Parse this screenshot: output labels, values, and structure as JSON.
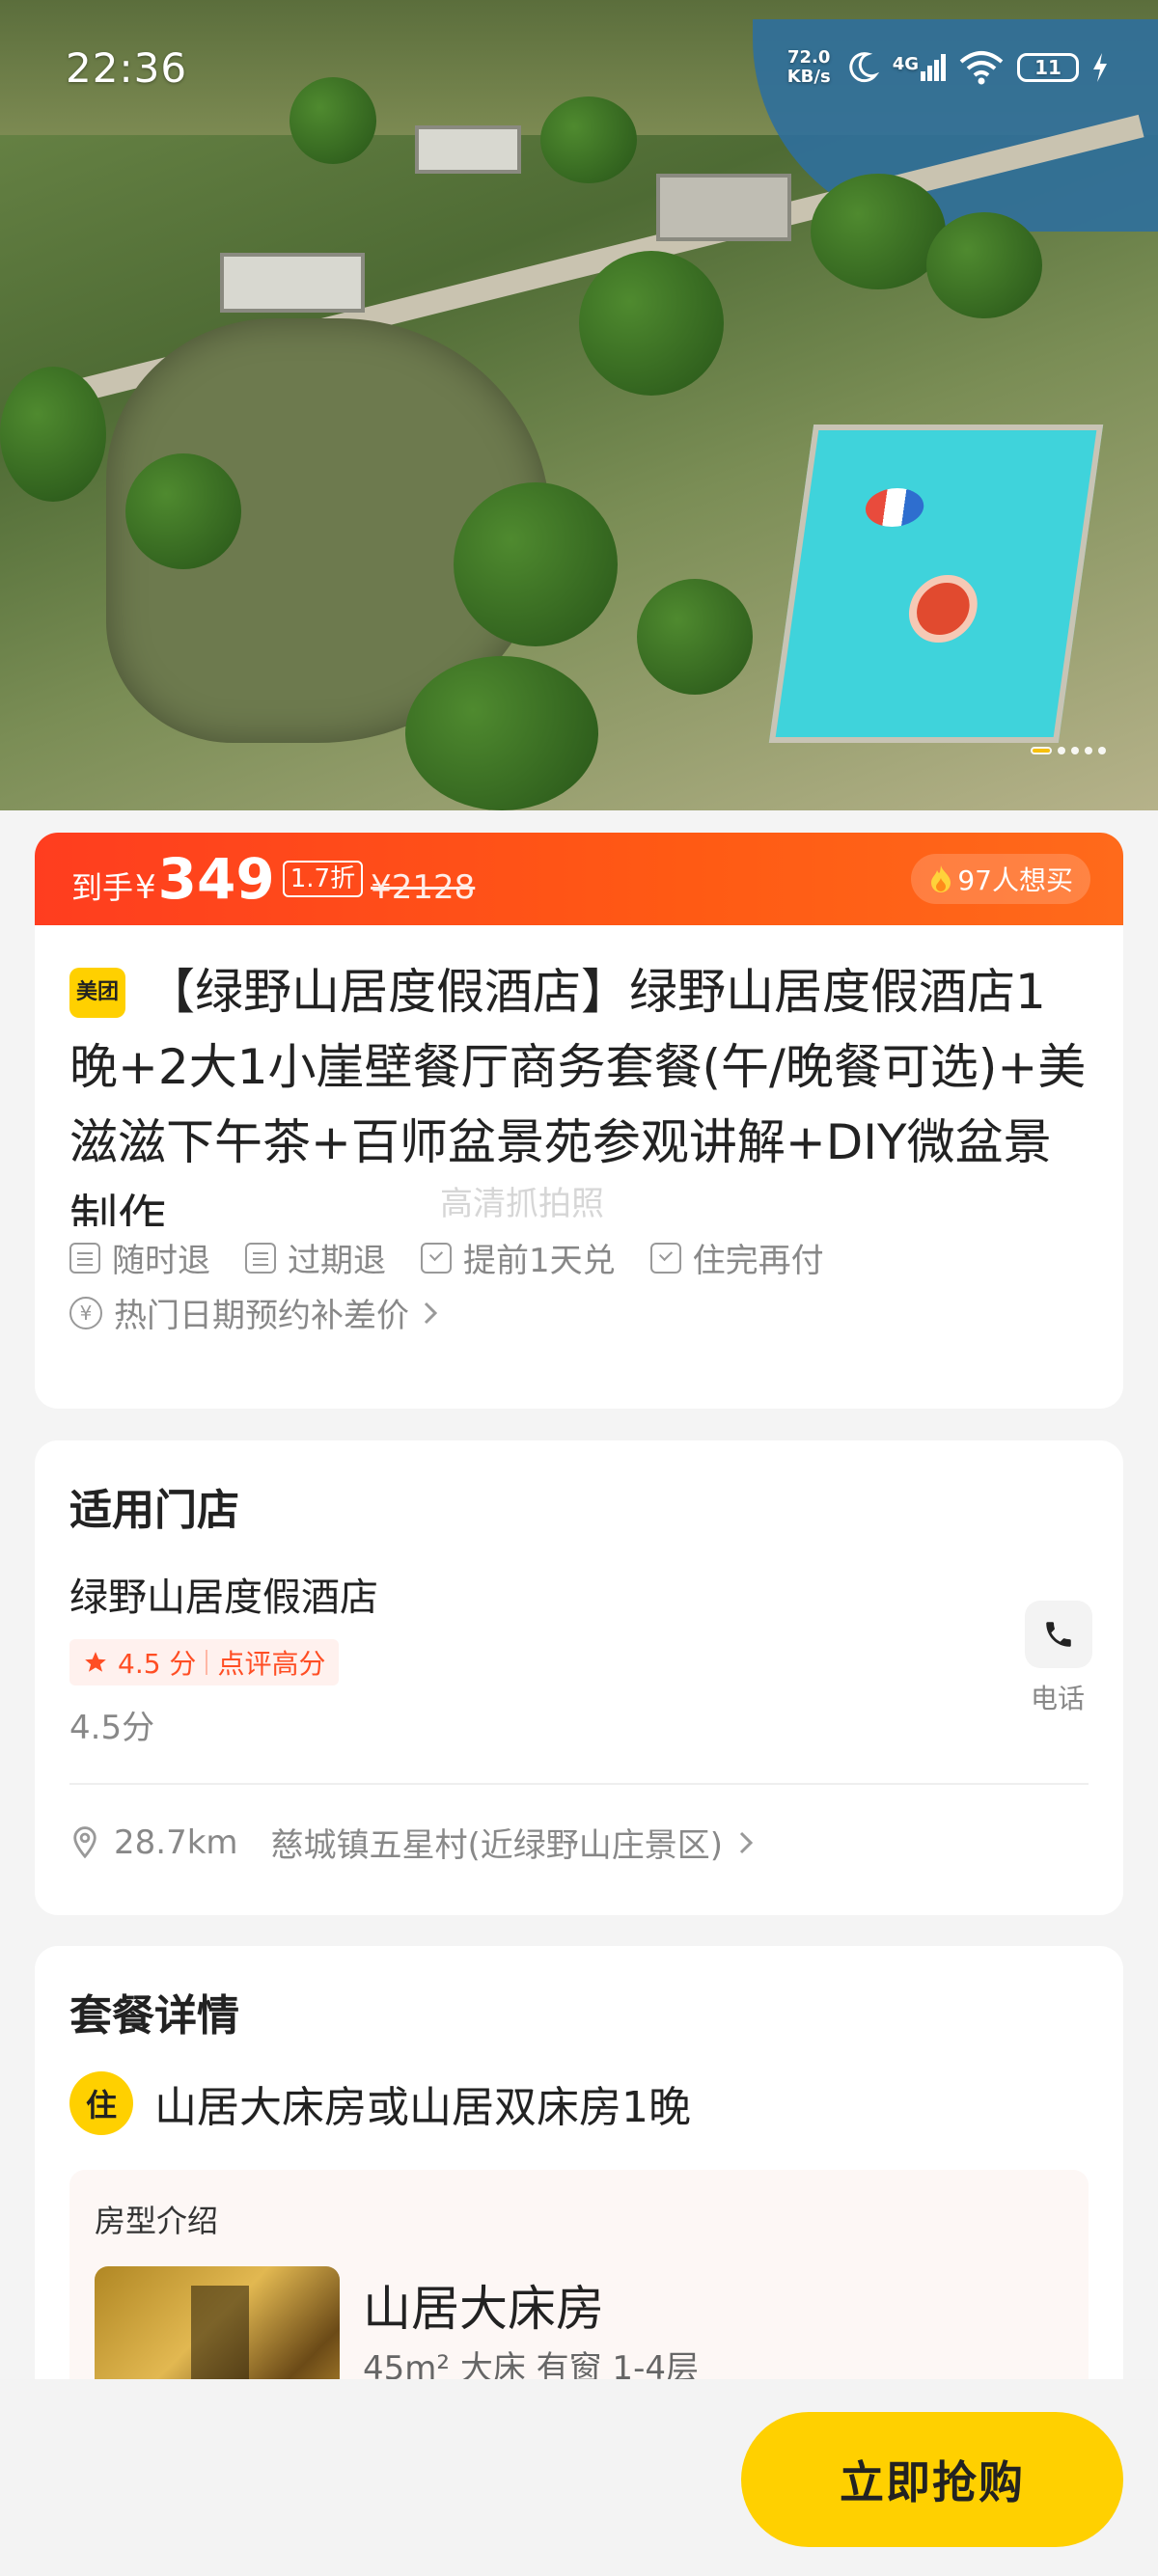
{
  "status_bar": {
    "time": "22:36",
    "net_speed_value": "72.0",
    "net_speed_unit": "KB/s",
    "network": "4G",
    "battery": "11"
  },
  "carousel": {
    "total": 5,
    "active_index": 0
  },
  "price": {
    "prefix": "到手",
    "currency": "¥",
    "value": "349",
    "discount": "1.7折",
    "original": "¥2128",
    "want_count": "97人想买"
  },
  "deal": {
    "brand_logo": "美团",
    "title": "【绿野山居度假酒店】绿野山居度假酒店1晚+2大1小崖壁餐厅商务套餐(午/晚餐可选)+美滋滋下午茶+百师盆景苑参观讲解+DIY微盆景制作...",
    "watermark": "高清抓拍照",
    "tags": [
      "随时退",
      "过期退",
      "提前1天兑",
      "住完再付"
    ],
    "note": "热门日期预约补差价"
  },
  "store": {
    "section_title": "适用门店",
    "name": "绿野山居度假酒店",
    "rating": "4.5 分",
    "rating_tag": "点评高分",
    "rating_text": "4.5分",
    "phone_label": "电话",
    "distance": "28.7km",
    "address": "慈城镇五星村(近绿野山庄景区)"
  },
  "package": {
    "section_title": "套餐详情",
    "item_icon": "住",
    "item_title": "山居大床房或山居双床房1晚",
    "room_label": "房型介绍",
    "room_name": "山居大床房",
    "room_spec": "45m²  大床  有窗  1-4层"
  },
  "bottom": {
    "buy_label": "立即抢购"
  },
  "colors": {
    "accent_orange": "#ff4a1c",
    "brand_yellow": "#ffd000"
  }
}
